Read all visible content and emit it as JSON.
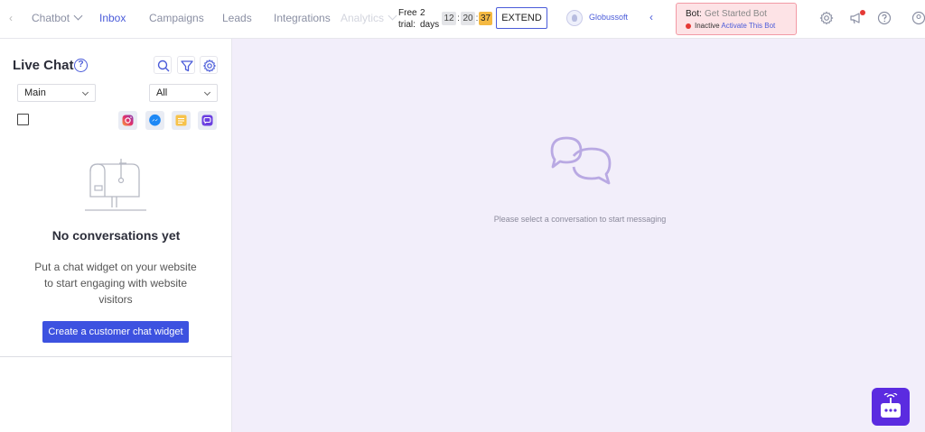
{
  "nav": {
    "items": [
      {
        "label": "Chatbot"
      },
      {
        "label": "Inbox"
      },
      {
        "label": "Campaigns"
      },
      {
        "label": "Leads"
      },
      {
        "label": "Integrations"
      },
      {
        "label": "Analytics"
      }
    ]
  },
  "trial": {
    "line1": "Free",
    "line2": "trial:",
    "days_count": "2",
    "days_label": "days",
    "hours": "12",
    "minutes": "20",
    "seconds": "37",
    "sep": ":",
    "extend_label": "EXTEND",
    "seconds_color": "#f5b942"
  },
  "workspace": {
    "name": "Globussoft",
    "chevron": "‹"
  },
  "bot": {
    "label": "Bot:",
    "name": "Get Started Bot",
    "status": "Inactive",
    "action": "Activate This Bot"
  },
  "sidebar": {
    "title": "Live Chat",
    "help": "?",
    "inbox_select": "Main",
    "filter_select": "All",
    "channels": [
      "instagram-icon",
      "messenger-icon",
      "sms-icon",
      "chat-icon"
    ],
    "empty_title": "No conversations yet",
    "empty_desc": "Put a chat widget on your website to start engaging with website visitors",
    "create_button": "Create a customer chat widget"
  },
  "main": {
    "message": "Please select a conversation to start messaging"
  },
  "colors": {
    "accent": "#4a5bd9",
    "primary_button": "#3d52e0",
    "main_bg": "#f2eefa",
    "bot_box_bg": "#fde3e6",
    "fab": "#5b2be0"
  }
}
